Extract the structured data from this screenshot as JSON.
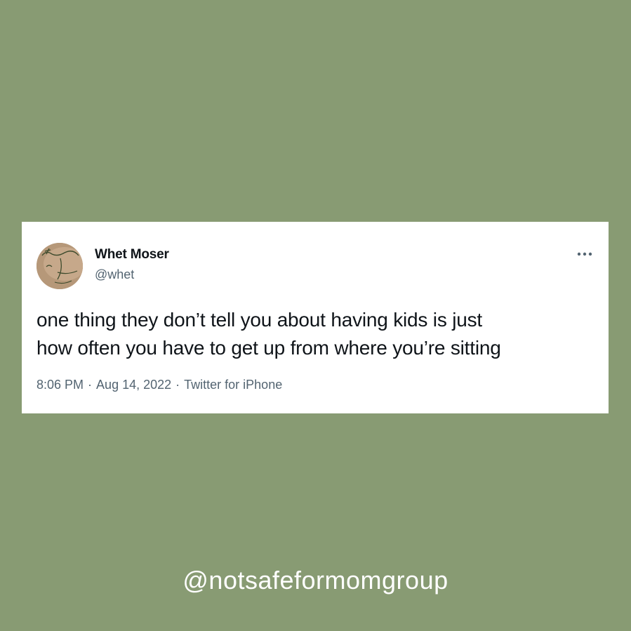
{
  "page": {
    "background_color": "#889b73"
  },
  "tweet": {
    "author": {
      "display_name": "Whet Moser",
      "handle": "@whet",
      "avatar_icon": "profile-photo"
    },
    "text_lines": [
      "one thing they don’t tell you about having kids is just",
      "how often you have to get up from where you’re sitting"
    ],
    "time": "8:06 PM",
    "separator": "·",
    "date": "Aug 14, 2022",
    "source": "Twitter for iPhone",
    "more_icon": "more-horizontal-icon",
    "card_color": "#ffffff",
    "text_color": "#0f1419",
    "secondary_color": "#536471"
  },
  "watermark": {
    "text": "@notsafeformomgroup",
    "color": "#ffffff"
  }
}
